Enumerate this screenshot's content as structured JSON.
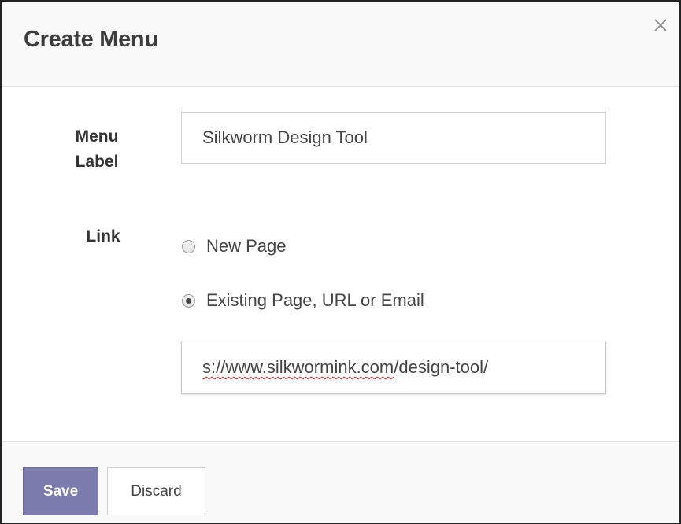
{
  "dialog": {
    "title": "Create Menu",
    "close_icon": "close-icon"
  },
  "form": {
    "menu_label_line1": "Menu",
    "menu_label_line2": "Label",
    "menu_label_value": "Silkworm Design Tool",
    "link_label": "Link",
    "link_options": [
      {
        "label": "New Page",
        "checked": false
      },
      {
        "label": "Existing Page, URL or Email",
        "checked": true
      }
    ],
    "url_value_misspelled": "s://www.silkwormink.com",
    "url_value_rest": "/design-tool/"
  },
  "footer": {
    "save_label": "Save",
    "discard_label": "Discard"
  },
  "colors": {
    "save_button_bg": "#7c7bad",
    "header_bg": "#f9f9f9",
    "spellcheck_underline": "#e02020"
  }
}
